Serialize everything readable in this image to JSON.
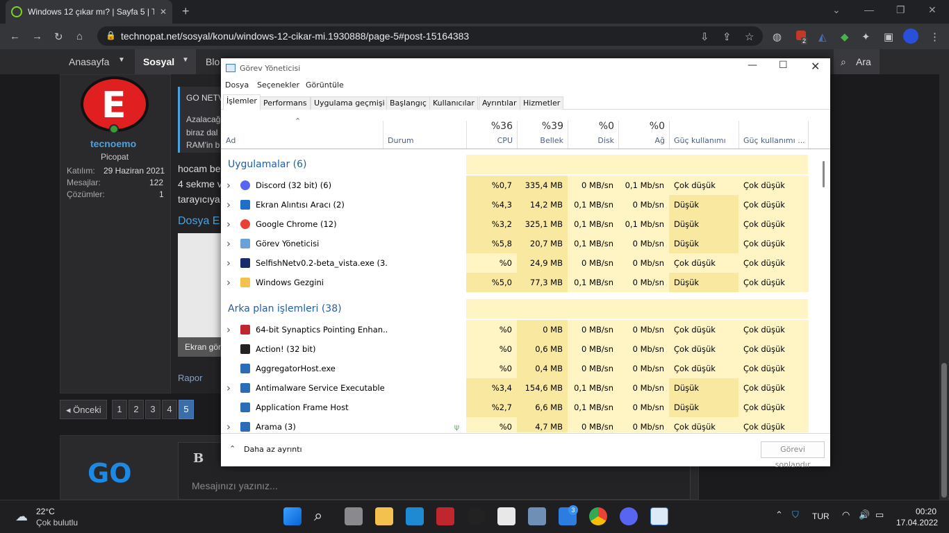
{
  "browser": {
    "tab_title": "Windows 12 çıkar mı? | Sayfa 5 | T",
    "url": "technopat.net/sosyal/konu/windows-12-cikar-mi.1930888/page-5#post-15164383",
    "ext_badge": "2"
  },
  "site": {
    "nav": [
      "Anasayfa",
      "Sosyal",
      "Blo"
    ],
    "search": "Ara",
    "quote_header": "GO NETV",
    "quote_text": [
      "Azalacağ",
      "biraz dal",
      "RAM'in b"
    ],
    "post_lines": [
      "hocam be",
      "4 sekme v",
      "tarayıcıya"
    ],
    "attachment_title": "Dosya E",
    "attachment_caption": "Ekran gör",
    "report": "Rapor",
    "user": {
      "name": "tecnoemo",
      "role": "Picopat",
      "stats": [
        {
          "label": "Katılım:",
          "value": "29 Haziran 2021"
        },
        {
          "label": "Mesajlar:",
          "value": "122"
        },
        {
          "label": "Çözümler:",
          "value": "1"
        }
      ]
    },
    "pagination": {
      "prev": "◂ Önceki",
      "pages": [
        "1",
        "2",
        "3",
        "4",
        "5"
      ],
      "current": "5"
    },
    "editor": {
      "bold": "B",
      "italic": "I",
      "placeholder": "Mesajınızı yazınız..."
    },
    "go_logo": "GO"
  },
  "taskmgr": {
    "title": "Görev Yöneticisi",
    "menu": [
      "Dosya",
      "Seçenekler",
      "Görüntüle"
    ],
    "tabs": [
      "İşlemler",
      "Performans",
      "Uygulama geçmişi",
      "Başlangıç",
      "Kullanıcılar",
      "Ayrıntılar",
      "Hizmetler"
    ],
    "columns": {
      "name": "Ad",
      "status": "Durum",
      "cpu_pct": "%36",
      "cpu": "CPU",
      "mem_pct": "%39",
      "mem": "Bellek",
      "disk_pct": "%0",
      "disk": "Disk",
      "net_pct": "%0",
      "net": "Ağ",
      "power": "Güç kullanımı",
      "power_trend": "Güç kullanımı ..."
    },
    "groups": [
      {
        "label": "Uygulamalar (6)",
        "rows": [
          {
            "name": "Discord (32 bit) (6)",
            "cpu": "%0,7",
            "mem": "335,4 MB",
            "disk": "0 MB/sn",
            "net": "0,1 Mb/sn",
            "power": "Çok düşük",
            "trend": "Çok düşük",
            "icon": "discord-icon",
            "expand": true
          },
          {
            "name": "Ekran Alıntısı Aracı (2)",
            "cpu": "%4,3",
            "mem": "14,2 MB",
            "disk": "0,1 MB/sn",
            "net": "0 Mb/sn",
            "power": "Düşük",
            "trend": "Çok düşük",
            "icon": "snipping-tool-icon",
            "expand": true
          },
          {
            "name": "Google Chrome (12)",
            "cpu": "%3,2",
            "mem": "325,1 MB",
            "disk": "0,1 MB/sn",
            "net": "0,1 Mb/sn",
            "power": "Düşük",
            "trend": "Çok düşük",
            "icon": "chrome-icon",
            "expand": true
          },
          {
            "name": "Görev Yöneticisi",
            "cpu": "%5,8",
            "mem": "20,7 MB",
            "disk": "0,1 MB/sn",
            "net": "0 Mb/sn",
            "power": "Düşük",
            "trend": "Çok düşük",
            "icon": "task-manager-icon",
            "expand": true
          },
          {
            "name": "SelfishNetv0.2-beta_vista.exe (3...",
            "cpu": "%0",
            "mem": "24,9 MB",
            "disk": "0 MB/sn",
            "net": "0 Mb/sn",
            "power": "Çok düşük",
            "trend": "Çok düşük",
            "icon": "window-icon",
            "expand": true
          },
          {
            "name": "Windows Gezgini",
            "cpu": "%5,0",
            "mem": "77,3 MB",
            "disk": "0,1 MB/sn",
            "net": "0 Mb/sn",
            "power": "Düşük",
            "trend": "Çok düşük",
            "icon": "folder-icon",
            "expand": true
          }
        ]
      },
      {
        "label": "Arka plan işlemleri (38)",
        "rows": [
          {
            "name": "64-bit Synaptics Pointing Enhan...",
            "cpu": "%0",
            "mem": "0 MB",
            "disk": "0 MB/sn",
            "net": "0 Mb/sn",
            "power": "Çok düşük",
            "trend": "Çok düşük",
            "icon": "synaptics-icon",
            "expand": true
          },
          {
            "name": "Action! (32 bit)",
            "cpu": "%0",
            "mem": "0,6 MB",
            "disk": "0 MB/sn",
            "net": "0 Mb/sn",
            "power": "Çok düşük",
            "trend": "Çok düşük",
            "icon": "action-icon",
            "expand": false
          },
          {
            "name": "AggregatorHost.exe",
            "cpu": "%0",
            "mem": "0,4 MB",
            "disk": "0 MB/sn",
            "net": "0 Mb/sn",
            "power": "Çok düşük",
            "trend": "Çok düşük",
            "icon": "app-icon",
            "expand": false
          },
          {
            "name": "Antimalware Service Executable",
            "cpu": "%3,4",
            "mem": "154,6 MB",
            "disk": "0,1 MB/sn",
            "net": "0 Mb/sn",
            "power": "Düşük",
            "trend": "Çok düşük",
            "icon": "app-icon",
            "expand": true
          },
          {
            "name": "Application Frame Host",
            "cpu": "%2,7",
            "mem": "6,6 MB",
            "disk": "0,1 MB/sn",
            "net": "0 Mb/sn",
            "power": "Düşük",
            "trend": "Çok düşük",
            "icon": "app-icon",
            "expand": false
          },
          {
            "name": "Arama (3)",
            "cpu": "%0",
            "mem": "4,7 MB",
            "disk": "0 MB/sn",
            "net": "0 Mb/sn",
            "power": "Çok düşük",
            "trend": "Çok düşük",
            "icon": "app-icon",
            "expand": true
          }
        ]
      }
    ],
    "footer_less": "Daha az ayrıntı",
    "end_task": "Görevi sonlandır"
  },
  "taskbar": {
    "temp": "22°C",
    "weather": "Çok bulutlu",
    "lang": "TUR",
    "time": "00:20",
    "date": "17.04.2022",
    "badge": "3"
  }
}
